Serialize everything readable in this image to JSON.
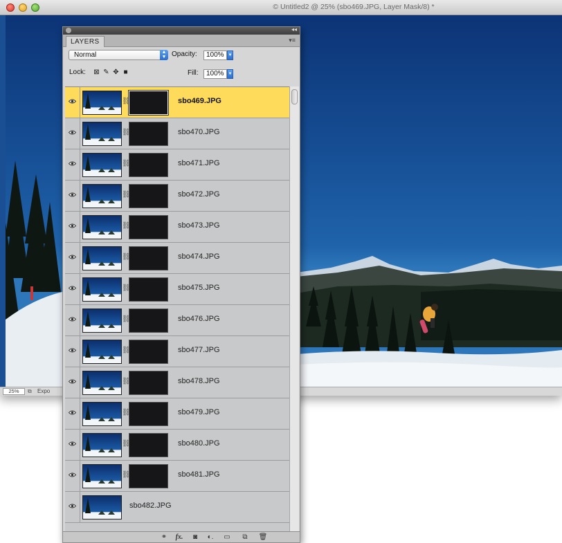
{
  "window": {
    "title": "© Untitled2 @ 25% (sbo469.JPG, Layer Mask/8) *"
  },
  "statusbar": {
    "zoom": "25%",
    "text": "Expo"
  },
  "panel": {
    "tab_label": "LAYERS",
    "blend_mode": "Normal",
    "opacity_label": "Opacity:",
    "opacity_value": "100%",
    "lock_label": "Lock:",
    "fill_label": "Fill:",
    "fill_value": "100%",
    "footer_icons": [
      "link-icon",
      "fx-icon",
      "add-mask-icon",
      "adjustment-layer-icon",
      "group-folder-icon",
      "new-layer-icon",
      "trash-icon"
    ]
  },
  "layers": [
    {
      "name": "sbo469.JPG",
      "selected": true,
      "has_mask": true
    },
    {
      "name": "sbo470.JPG",
      "selected": false,
      "has_mask": true
    },
    {
      "name": "sbo471.JPG",
      "selected": false,
      "has_mask": true
    },
    {
      "name": "sbo472.JPG",
      "selected": false,
      "has_mask": true
    },
    {
      "name": "sbo473.JPG",
      "selected": false,
      "has_mask": true
    },
    {
      "name": "sbo474.JPG",
      "selected": false,
      "has_mask": true
    },
    {
      "name": "sbo475.JPG",
      "selected": false,
      "has_mask": true
    },
    {
      "name": "sbo476.JPG",
      "selected": false,
      "has_mask": true
    },
    {
      "name": "sbo477.JPG",
      "selected": false,
      "has_mask": true
    },
    {
      "name": "sbo478.JPG",
      "selected": false,
      "has_mask": true
    },
    {
      "name": "sbo479.JPG",
      "selected": false,
      "has_mask": true
    },
    {
      "name": "sbo480.JPG",
      "selected": false,
      "has_mask": true
    },
    {
      "name": "sbo481.JPG",
      "selected": false,
      "has_mask": true
    },
    {
      "name": "sbo482.JPG",
      "selected": false,
      "has_mask": false
    }
  ],
  "colors": {
    "selected_row": "#ffdb5c",
    "sky": "#1a4f94",
    "mask": "#161518"
  }
}
